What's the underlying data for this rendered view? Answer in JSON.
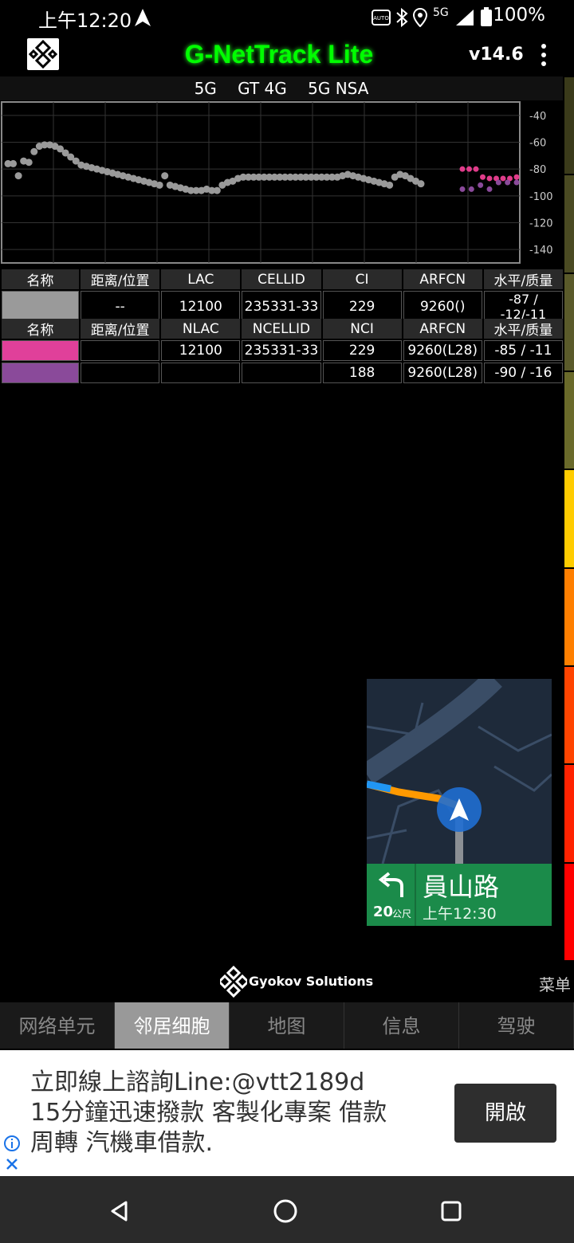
{
  "status": {
    "time": "上午12:20",
    "network": "5G",
    "battery": "100%"
  },
  "appbar": {
    "title": "G-NetTrack Lite",
    "version": "v14.6"
  },
  "techbar": [
    "5G",
    "GT 4G",
    "5G NSA"
  ],
  "chart_data": {
    "type": "scatter",
    "title": "",
    "xlabel": "",
    "ylabel": "",
    "ylim": [
      -150,
      -30
    ],
    "yticks": [
      -40,
      -60,
      -80,
      -100,
      -120,
      -140
    ],
    "grid": true,
    "series": [
      {
        "color": "#9a9a9a",
        "values": [
          -76,
          -76,
          -85,
          -74,
          -75,
          -67,
          -63,
          -62,
          -62,
          -63,
          -65,
          -68,
          -71,
          -74,
          -77,
          -78,
          -79,
          -80,
          -81,
          -82,
          -83,
          -84,
          -85,
          -86,
          -87,
          -88,
          -89,
          -90,
          -91,
          -92,
          -85,
          -92,
          -93,
          -94,
          -95,
          -96,
          -96,
          -96,
          -95,
          -96,
          -96,
          -92,
          -90,
          -89,
          -87,
          -86,
          -86,
          -86,
          -86,
          -86,
          -86,
          -86,
          -86,
          -86,
          -86,
          -86,
          -86,
          -86,
          -86,
          -86,
          -86,
          -86,
          -86,
          -86,
          -85,
          -84,
          -85,
          -86,
          -87,
          -88,
          -89,
          -90,
          -91,
          -92,
          -86,
          -84,
          -85,
          -87,
          -89,
          -91
        ]
      },
      {
        "color": "#e03c8a",
        "values": [
          -80,
          -80,
          -80,
          -86,
          -87,
          -87,
          -87,
          -87,
          -86
        ]
      },
      {
        "color": "#8a4a9a",
        "values": [
          -95,
          -95,
          -92,
          -95,
          -90,
          -90,
          -90
        ]
      }
    ]
  },
  "serving": {
    "headers": [
      "名称",
      "距离/位置",
      "LAC",
      "CELLID",
      "CI",
      "ARFCN",
      "水平/质量"
    ],
    "row": {
      "swatch": "#9a9a9a",
      "cells": [
        "",
        "--",
        "12100",
        "235331-33",
        "229",
        "9260()",
        "-87 / -12/-11"
      ]
    }
  },
  "neighbors": {
    "headers": [
      "名称",
      "距离/位置",
      "NLAC",
      "NCELLID",
      "NCI",
      "ARFCN",
      "水平/质量"
    ],
    "rows": [
      {
        "swatch": "#e0409a",
        "cells": [
          "",
          "",
          "12100",
          "235331-33",
          "229",
          "9260(L28)",
          "-85 / -11"
        ]
      },
      {
        "swatch": "#8a4a9a",
        "cells": [
          "",
          "",
          "",
          "",
          "188",
          "9260(L28)",
          "-90 / -16"
        ]
      }
    ]
  },
  "nav": {
    "street": "員山路",
    "distance": "20",
    "unit": "公尺",
    "eta": "上午12:30"
  },
  "brand": "Gyokov Solutions",
  "menu_label": "菜单",
  "tabs": [
    {
      "label": "网络单元",
      "active": false
    },
    {
      "label": "邻居细胞",
      "active": true
    },
    {
      "label": "地图",
      "active": false
    },
    {
      "label": "信息",
      "active": false
    },
    {
      "label": "驾驶",
      "active": false
    }
  ],
  "ad": {
    "lines": [
      "立即線上諮詢Line:@vtt2189d",
      "15分鐘迅速撥款 客製化專案 借款",
      "周轉 汽機車借款."
    ],
    "button": "開啟"
  },
  "strip_colors": [
    "#3a3a1a",
    "#4a4a22",
    "#5a5a2a",
    "#6a6a2a",
    "#ffcc00",
    "#ff7f00",
    "#ff4400",
    "#ff2200",
    "#ff0000"
  ]
}
